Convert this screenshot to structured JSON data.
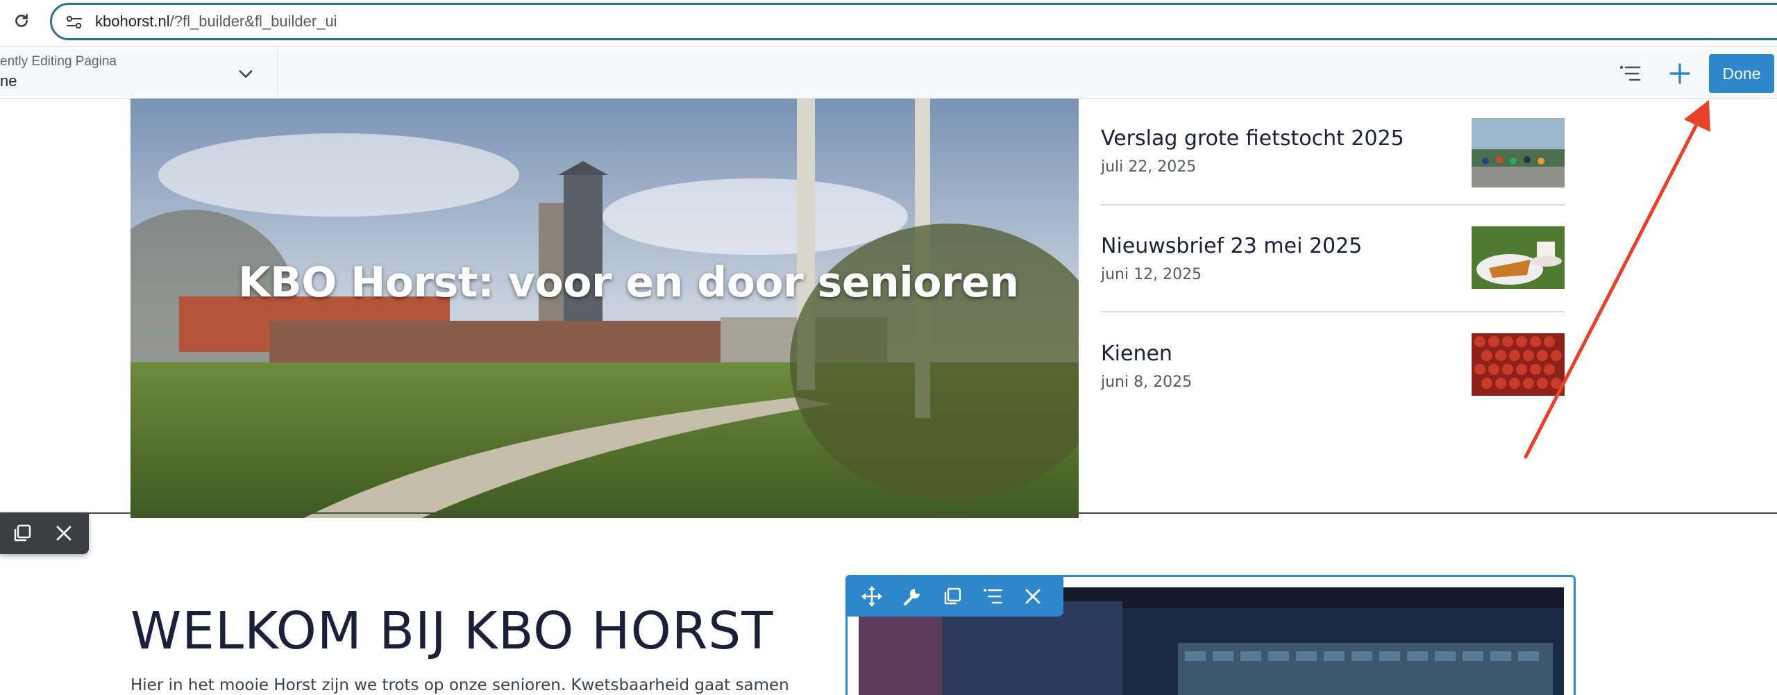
{
  "browser": {
    "url_host": "kbohorst.nl",
    "url_path": "/?fl_builder&fl_builder_ui"
  },
  "builder_bar": {
    "editing_label": "ently Editing Pagina",
    "editing_value": "ne",
    "done_label": "Done"
  },
  "hero": {
    "title": "KBO Horst: voor en door senioren"
  },
  "posts": [
    {
      "title": "Verslag grote fietstocht 2025",
      "date": "juli 22, 2025"
    },
    {
      "title": "Nieuwsbrief 23 mei 2025",
      "date": "juni 12, 2025"
    },
    {
      "title": "Kienen",
      "date": "juni 8, 2025"
    }
  ],
  "welcome": {
    "title": "WELKOM BIJ KBO HORST",
    "text": "Hier in het mooie Horst zijn we trots op onze senioren. Kwetsbaarheid gaat samen"
  },
  "icons": {
    "reload": "reload-icon",
    "site_info": "site-info-icon",
    "chevron": "chevron-down-icon",
    "outline": "outline-icon",
    "add": "plus-icon",
    "move": "move-icon",
    "settings": "wrench-icon",
    "duplicate": "duplicate-icon",
    "columns": "outline-icon",
    "close": "close-icon"
  },
  "colors": {
    "accent": "#2e87c8",
    "url_border": "#2d6f8e",
    "annotation": "#e8412a",
    "toolbar_dark": "#3b3f45",
    "heading": "#1a1f3a"
  }
}
